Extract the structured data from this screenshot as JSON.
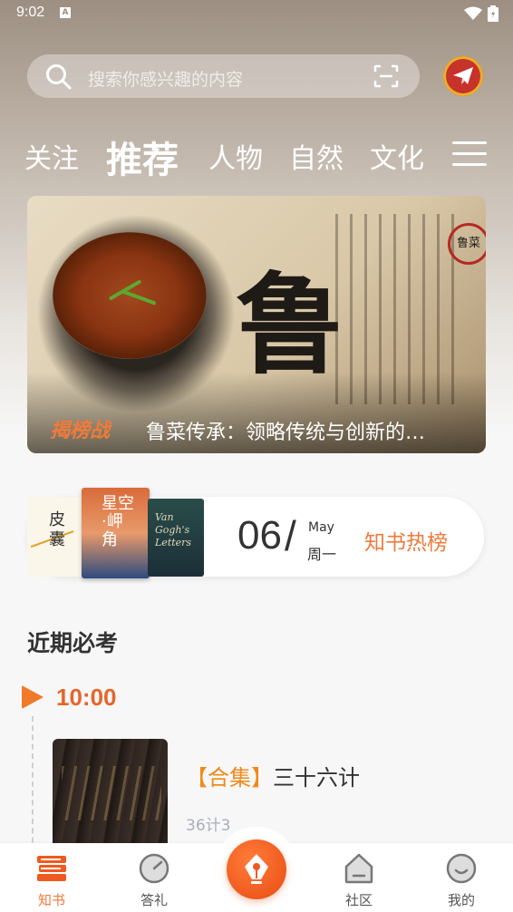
{
  "status_bar": {
    "time": "9:02",
    "notification_glyph": "A"
  },
  "search": {
    "placeholder": "搜索你感兴趣的内容"
  },
  "tabs": [
    {
      "label": "关注",
      "active": false
    },
    {
      "label": "推荐",
      "active": true
    },
    {
      "label": "人物",
      "active": false
    },
    {
      "label": "自然",
      "active": false
    },
    {
      "label": "文化",
      "active": false
    }
  ],
  "banner": {
    "tag": "揭榜战",
    "title": "鲁菜传承：领略传统与创新的…",
    "big_char": "鲁",
    "seal": "鲁菜"
  },
  "hot_list": {
    "day": "06",
    "slash": "/",
    "month": "May",
    "weekday": "周一",
    "label": "知书热榜",
    "books": [
      {
        "title": "皮囊"
      },
      {
        "title": "星空·岬角"
      },
      {
        "title": "Van Gogh's Letters"
      }
    ]
  },
  "section": {
    "title": "近期必考"
  },
  "timeline": {
    "time": "10:00",
    "item": {
      "tag": "【合集】",
      "title": "三十六计",
      "subtitle": "36计3"
    }
  },
  "bottom_nav": [
    {
      "label": "知书",
      "icon": "books-icon",
      "active": true
    },
    {
      "label": "答礼",
      "icon": "compass-icon",
      "active": false
    },
    {
      "label": "",
      "icon": "pen-nib-icon",
      "active": false
    },
    {
      "label": "社区",
      "icon": "house-icon",
      "active": false
    },
    {
      "label": "我的",
      "icon": "smile-icon",
      "active": false
    }
  ],
  "colors": {
    "accent": "#ef7a3c",
    "timeline": "#e6662a",
    "tag": "#ef8a1a",
    "muted": "#a8aebe"
  }
}
